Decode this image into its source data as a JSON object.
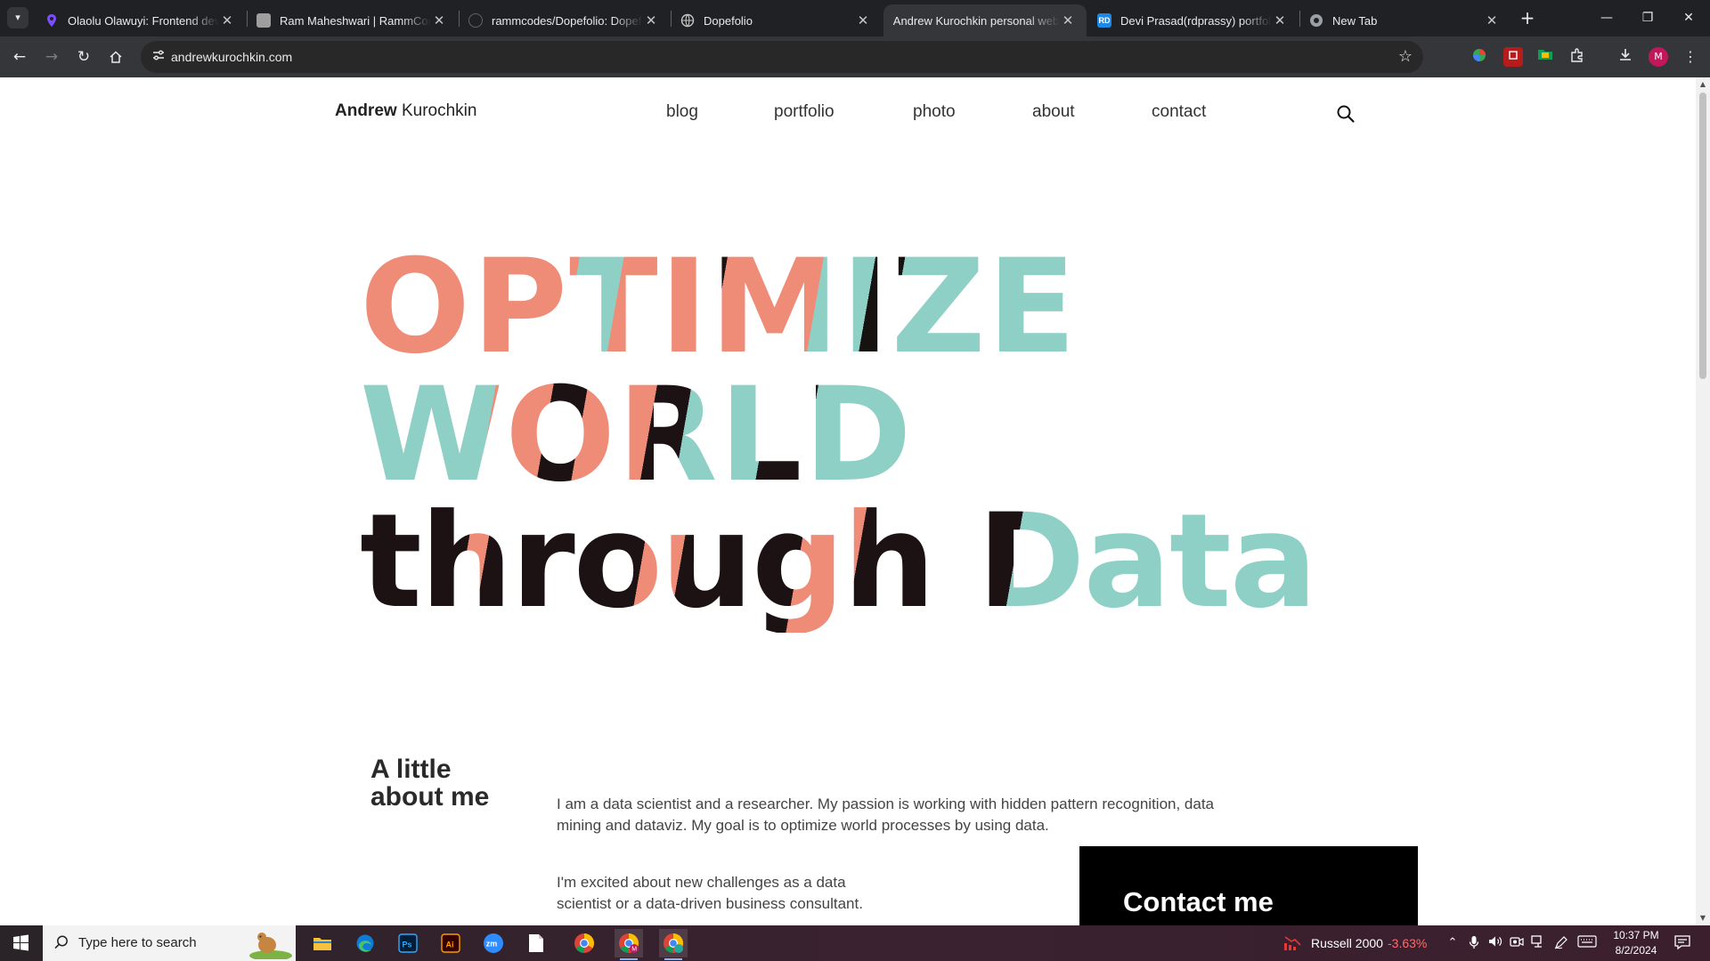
{
  "browser": {
    "tabs": [
      {
        "title": "Olaolu Olawuyi: Frontend deve",
        "favicon_color": "#7c4dff"
      },
      {
        "title": "Ram Maheshwari | RammCodes",
        "favicon_color": "#9e9e9e"
      },
      {
        "title": "rammcodes/Dopefolio: Dopefolio",
        "favicon_color": "#202124"
      },
      {
        "title": "Dopefolio",
        "favicon_color": "#5f6368"
      },
      {
        "title": "Andrew Kurochkin personal web",
        "favicon_color": "#35363a"
      },
      {
        "title": "Devi Prasad(rdprassy) portfolio",
        "favicon_color": "#1e88e5",
        "favicon_text": "RD"
      },
      {
        "title": "New Tab",
        "favicon_color": "#5f6368"
      }
    ],
    "active_tab_index": 4,
    "new_tab_symbol": "+",
    "url": "andrewkurochkin.com",
    "profile_initial": "M"
  },
  "site": {
    "brand_first": "Andrew",
    "brand_last": "Kurochkin",
    "nav": [
      "blog",
      "portfolio",
      "photo",
      "about",
      "contact"
    ],
    "hero": [
      "OPTIMIZE",
      "WORLD",
      "through Data"
    ],
    "hero_colors": {
      "salmon": "#ef8c78",
      "teal": "#8fd0c6",
      "dark": "#1c1214"
    },
    "about_heading": "A little about me",
    "about_p1": "I am a data scientist and a researcher. My passion is working with hidden pattern recognition, data mining and dataviz. My goal is to optimize world processes by using data.",
    "about_p2": "I'm excited about new challenges as a data scientist or a data-driven business consultant.",
    "contact_cta": "Contact me"
  },
  "taskbar": {
    "search_placeholder": "Type here to search",
    "ticker_name": "Russell 2000",
    "ticker_change": "-3.63%",
    "time": "10:37 PM",
    "date": "8/2/2024"
  }
}
